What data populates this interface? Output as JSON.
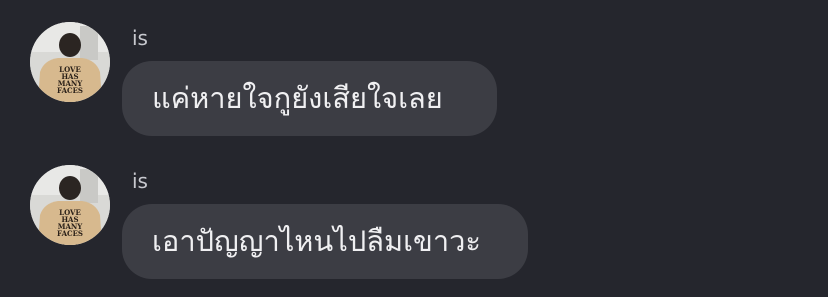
{
  "messages": [
    {
      "sender": "is",
      "text": "แค่หายใจกูยังเสียใจเลย",
      "avatar": {
        "shirt_text": [
          "LOVE",
          "HAS",
          "MANY",
          "FACES"
        ]
      }
    },
    {
      "sender": "is",
      "text": "เอาปัญญาไหนไปลืมเขาวะ",
      "avatar": {
        "shirt_text": [
          "LOVE",
          "HAS",
          "MANY",
          "FACES"
        ]
      }
    }
  ],
  "colors": {
    "background": "#25262d",
    "bubble": "#3c3d44",
    "sender_text": "#c8c9cf",
    "message_text": "#f0f0f2"
  }
}
